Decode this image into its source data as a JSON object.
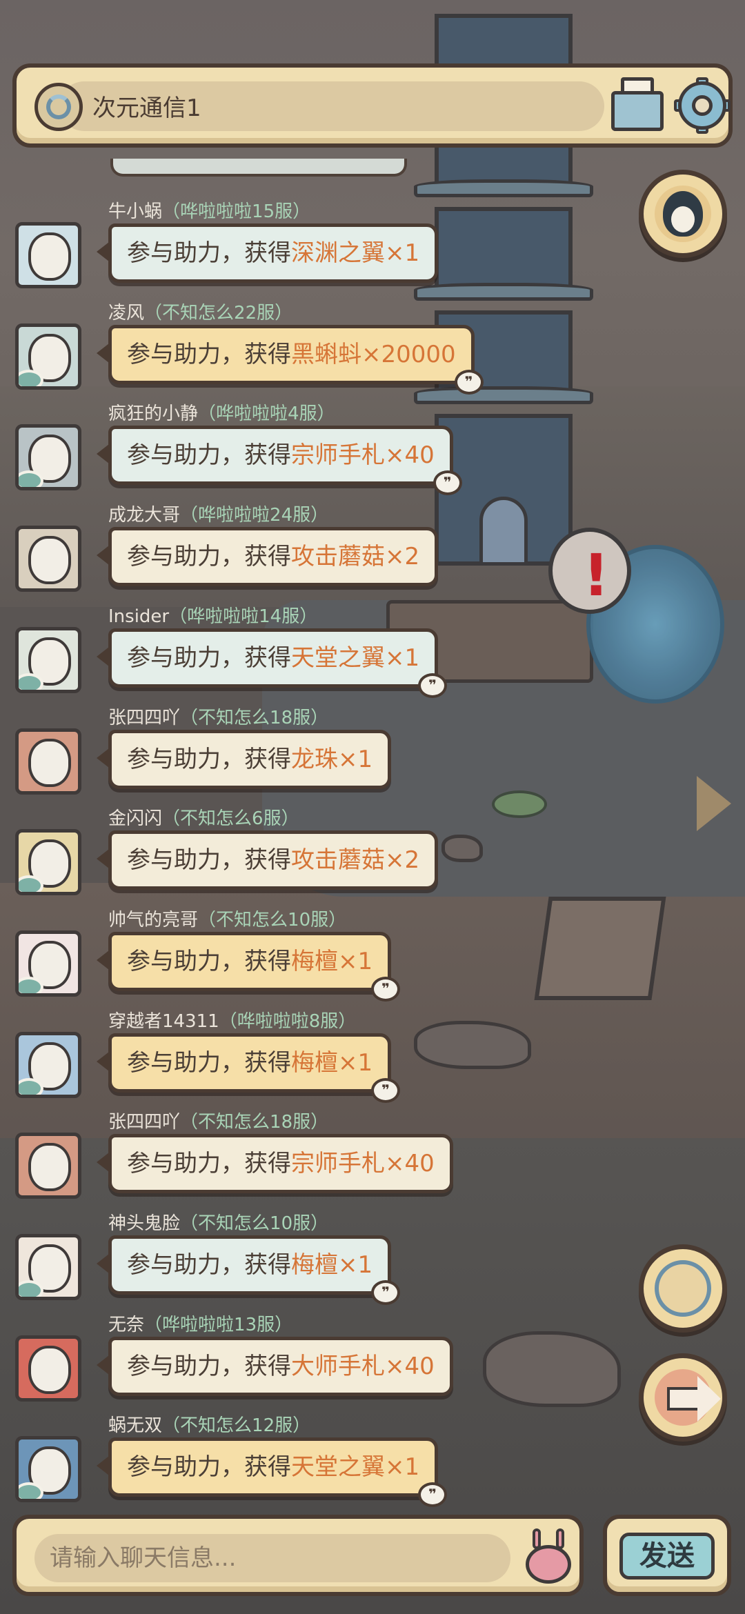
{
  "header": {
    "channel_name": "次元通信1",
    "channel_icon": "portal-icon",
    "mail_icon": "mail-icon",
    "settings_icon": "gear-icon"
  },
  "messages": [
    {
      "name": "牛小蜗",
      "server": "哗啦啦啦15服",
      "prefix": "参与助力，获得",
      "item": "深渊之翼×1",
      "bubble": "mint",
      "quote": false,
      "eye": false
    },
    {
      "name": "凌风",
      "server": "不知怎么22服",
      "prefix": "参与助力，获得",
      "item": "黑蝌蚪×20000",
      "bubble": "gold",
      "quote": true,
      "eye": true
    },
    {
      "name": "疯狂的小静",
      "server": "哗啦啦啦4服",
      "prefix": "参与助力，获得",
      "item": "宗师手札×40",
      "bubble": "mint",
      "quote": true,
      "eye": true
    },
    {
      "name": "成龙大哥",
      "server": "哗啦啦啦24服",
      "prefix": "参与助力，获得",
      "item": "攻击蘑菇×2",
      "bubble": "cream",
      "quote": false,
      "eye": false
    },
    {
      "name": "Insider",
      "server": "哗啦啦啦14服",
      "prefix": "参与助力，获得",
      "item": "天堂之翼×1",
      "bubble": "mint",
      "quote": true,
      "eye": true
    },
    {
      "name": "张四四吖",
      "server": "不知怎么18服",
      "prefix": "参与助力，获得",
      "item": "龙珠×1",
      "bubble": "cream",
      "quote": false,
      "eye": false
    },
    {
      "name": "金闪闪",
      "server": "不知怎么6服",
      "prefix": "参与助力，获得",
      "item": "攻击蘑菇×2",
      "bubble": "cream",
      "quote": false,
      "eye": true
    },
    {
      "name": "帅气的亮哥",
      "server": "不知怎么10服",
      "prefix": "参与助力，获得",
      "item": "梅檀×1",
      "bubble": "gold",
      "quote": true,
      "eye": true
    },
    {
      "name": "穿越者14311",
      "server": "哗啦啦啦8服",
      "prefix": "参与助力，获得",
      "item": "梅檀×1",
      "bubble": "gold",
      "quote": true,
      "eye": true
    },
    {
      "name": "张四四吖",
      "server": "不知怎么18服",
      "prefix": "参与助力，获得",
      "item": "宗师手札×40",
      "bubble": "cream",
      "quote": false,
      "eye": false
    },
    {
      "name": "神头鬼脸",
      "server": "不知怎么10服",
      "prefix": "参与助力，获得",
      "item": "梅檀×1",
      "bubble": "mint",
      "quote": true,
      "eye": true
    },
    {
      "name": "无奈",
      "server": "哗啦啦啦13服",
      "prefix": "参与助力，获得",
      "item": "大师手札×40",
      "bubble": "cream",
      "quote": false,
      "eye": false
    },
    {
      "name": "蜗无双",
      "server": "不知怎么12服",
      "prefix": "参与助力，获得",
      "item": "天堂之翼×1",
      "bubble": "gold",
      "quote": true,
      "eye": true
    }
  ],
  "side_buttons": {
    "qq_icon": "penguin-icon",
    "portal_icon": "portal-icon",
    "next_icon": "arrow-right-icon"
  },
  "footer": {
    "input_placeholder": "请输入聊天信息...",
    "emoji_icon": "snail-emoji-icon",
    "send_label": "发送"
  },
  "colors": {
    "panel": "#f0dfb2",
    "outline": "#4a3b32",
    "item_text": "#d67537",
    "server_text": "#a9d4b7"
  }
}
